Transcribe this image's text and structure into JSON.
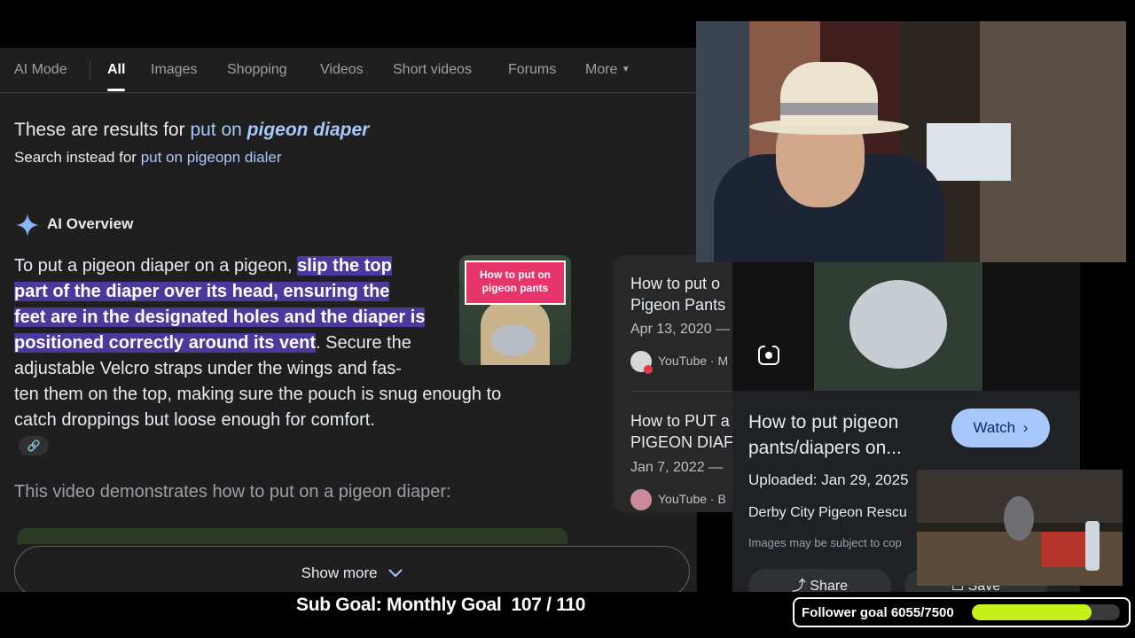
{
  "tabs": {
    "ai_mode": "AI Mode",
    "all": "All",
    "images": "Images",
    "shopping": "Shopping",
    "videos": "Videos",
    "short_videos": "Short videos",
    "forums": "Forums",
    "more": "More"
  },
  "correction": {
    "prefix": "These are results for",
    "query_plain": "put on",
    "query_emph": "pigeon diaper",
    "instead_prefix": "Search instead for",
    "instead_query": "put on pigeopn dialer"
  },
  "ai_overview": {
    "title": "AI Overview",
    "lead": "To put a pigeon diaper on a pigeon,",
    "l1_hl": "slip the top",
    "l2_hl": "part of the diaper over its head, ensuring the",
    "l3_hl": "feet are in the designated holes and the diaper is",
    "l4_hl": "positioned correctly around its vent",
    "l4_rest": ". Secure the",
    "l5": "adjustable Velcro straps under the wings and fas-",
    "l6": "ten them on the top, making sure the pouch is snug enough to",
    "l7": "catch droppings but loose enough for comfort.",
    "video_intro": "This video demonstrates how to put on a pigeon diaper:",
    "thumb_caption": "How to put on pigeon pants",
    "show_more": "Show more"
  },
  "side_cards": [
    {
      "title1": "How to put o",
      "title2": "Pigeon Pants",
      "date": "Apr 13, 2020 —",
      "source": "YouTube · M"
    },
    {
      "title1": "How to PUT a",
      "title2": "PIGEON DIAF",
      "date": "Jan 7, 2022 —",
      "source": "YouTube · B"
    }
  ],
  "video_panel": {
    "title1": "How to put pigeon",
    "title2": "pants/diapers on...",
    "watch": "Watch",
    "uploaded": "Uploaded: Jan 29, 2025",
    "channel": "Derby City Pigeon Rescu",
    "disclaimer": "Images may be subject to cop",
    "share": "Share",
    "save": "Save"
  },
  "stream": {
    "sub_goal": "Sub Goal: Monthly Goal  107 / 110",
    "follower_goal": "Follower goal 6055/7500",
    "follower_progress": 0.807
  }
}
